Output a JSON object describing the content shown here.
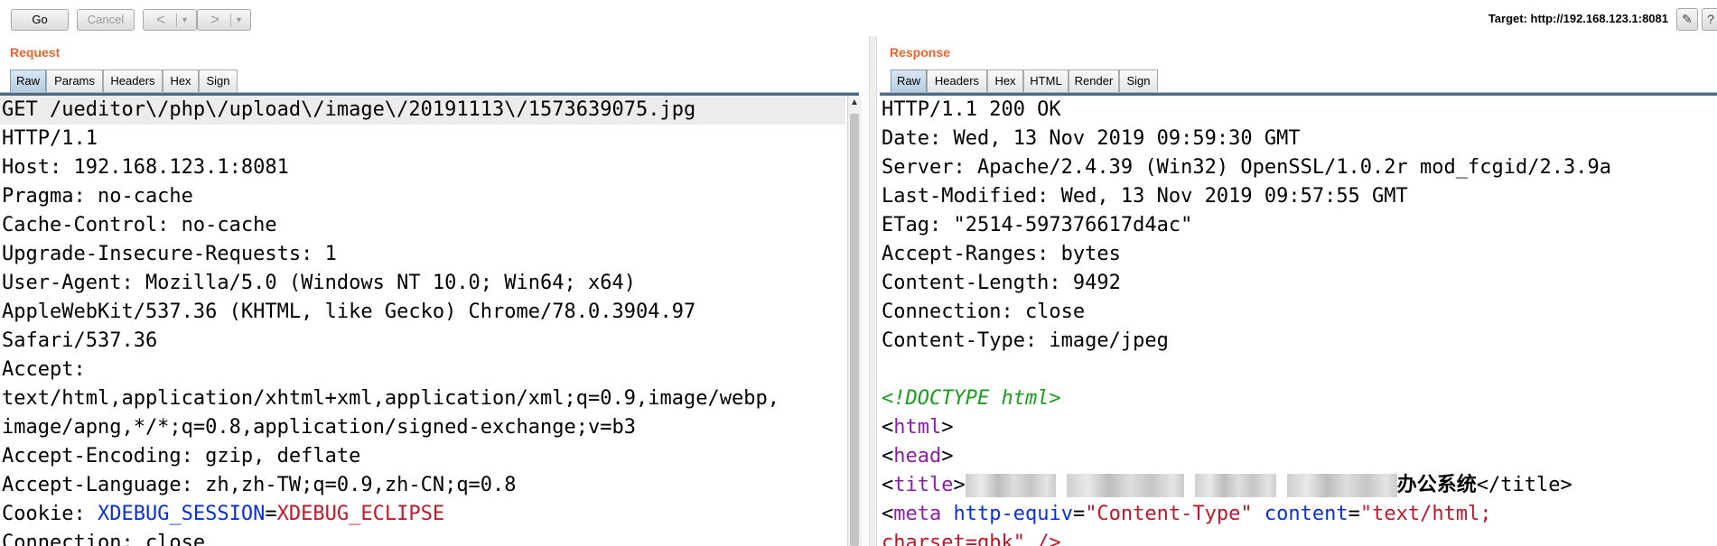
{
  "toolbar": {
    "go_label": "Go",
    "cancel_label": "Cancel",
    "back_arrow": "<",
    "forward_arrow": ">",
    "dropdown_glyph": "▼",
    "target_label": "Target: http://192.168.123.1:8081",
    "icons": [
      "pencil-icon",
      "help-icon"
    ]
  },
  "request": {
    "title": "Request",
    "tabs": [
      "Raw",
      "Params",
      "Headers",
      "Hex",
      "Sign"
    ],
    "active_tab": "Raw",
    "lines": [
      "GET /ueditor\\/php\\/upload\\/image\\/20191113\\/1573639075.jpg",
      "HTTP/1.1",
      "Host: 192.168.123.1:8081",
      "Pragma: no-cache",
      "Cache-Control: no-cache",
      "Upgrade-Insecure-Requests: 1",
      "User-Agent: Mozilla/5.0 (Windows NT 10.0; Win64; x64)",
      "AppleWebKit/537.36 (KHTML, like Gecko) Chrome/78.0.3904.97",
      "Safari/537.36",
      "Accept:",
      "text/html,application/xhtml+xml,application/xml;q=0.9,image/webp,",
      "image/apng,*/*;q=0.8,application/signed-exchange;v=b3",
      "Accept-Encoding: gzip, deflate",
      "Accept-Language: zh,zh-TW;q=0.9,zh-CN;q=0.8"
    ],
    "cookie_prefix": "Cookie: ",
    "cookie_key": "XDEBUG_SESSION",
    "cookie_eq": "=",
    "cookie_value": "XDEBUG_ECLIPSE",
    "last_line": "Connection: close"
  },
  "response": {
    "title": "Response",
    "tabs": [
      "Raw",
      "Headers",
      "Hex",
      "HTML",
      "Render",
      "Sign"
    ],
    "active_tab": "Raw",
    "lines": [
      "HTTP/1.1 200 OK",
      "Date: Wed, 13 Nov 2019 09:59:30 GMT",
      "Server: Apache/2.4.39 (Win32) OpenSSL/1.0.2r mod_fcgid/2.3.9a",
      "Last-Modified: Wed, 13 Nov 2019 09:57:55 GMT",
      "ETag: \"2514-597376617d4ac\"",
      "Accept-Ranges: bytes",
      "Content-Length: 9492",
      "Connection: close",
      "Content-Type: image/jpeg",
      ""
    ],
    "doctype": "<!DOCTYPE html>",
    "html_open": "html",
    "head_open": "head",
    "lt": "<",
    "gt": ">",
    "title_tag": "title",
    "title_text_visible": "办公系统",
    "title_close": "</title>",
    "meta_tag": "meta",
    "meta_attr1": "http-equiv",
    "meta_eq": "=",
    "meta_val1": "\"Content-Type\"",
    "meta_attr2": "content",
    "meta_val2": "\"text/html;",
    "meta_continued": "charset=gbk\" />"
  }
}
